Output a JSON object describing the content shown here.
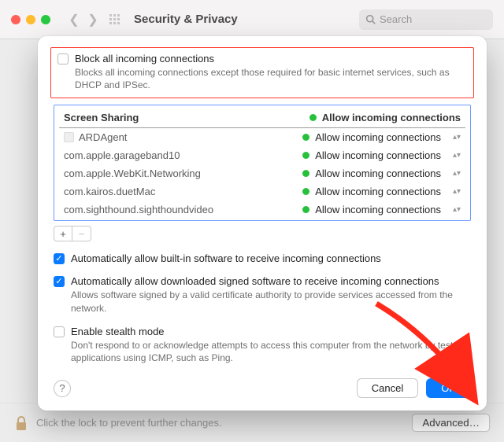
{
  "window": {
    "title": "Security & Privacy",
    "search_placeholder": "Search",
    "lock_hint": "Click the lock to prevent further changes.",
    "advanced_label": "Advanced…"
  },
  "section_block": {
    "checkbox_label": "Block all incoming connections",
    "description": "Blocks all incoming connections except those required for basic internet services, such as DHCP and IPSec."
  },
  "firewall_table": {
    "header_app": "Screen Sharing",
    "header_status": "Allow incoming connections",
    "rows": [
      {
        "app": "ARDAgent",
        "status": "Allow incoming connections"
      },
      {
        "app": "com.apple.garageband10",
        "status": "Allow incoming connections"
      },
      {
        "app": "com.apple.WebKit.Networking",
        "status": "Allow incoming connections"
      },
      {
        "app": "com.kairos.duetMac",
        "status": "Allow incoming connections"
      },
      {
        "app": "com.sighthound.sighthoundvideo",
        "status": "Allow incoming connections"
      }
    ]
  },
  "options": {
    "auto_builtin": "Automatically allow built-in software to receive incoming connections",
    "auto_signed": "Automatically allow downloaded signed software to receive incoming connections",
    "auto_signed_desc": "Allows software signed by a valid certificate authority to provide services accessed from the network.",
    "stealth": "Enable stealth mode",
    "stealth_desc": "Don't respond to or acknowledge attempts to access this computer from the network by test applications using ICMP, such as Ping."
  },
  "buttons": {
    "cancel": "Cancel",
    "ok": "OK",
    "plus": "+",
    "minus": "−",
    "help": "?"
  }
}
